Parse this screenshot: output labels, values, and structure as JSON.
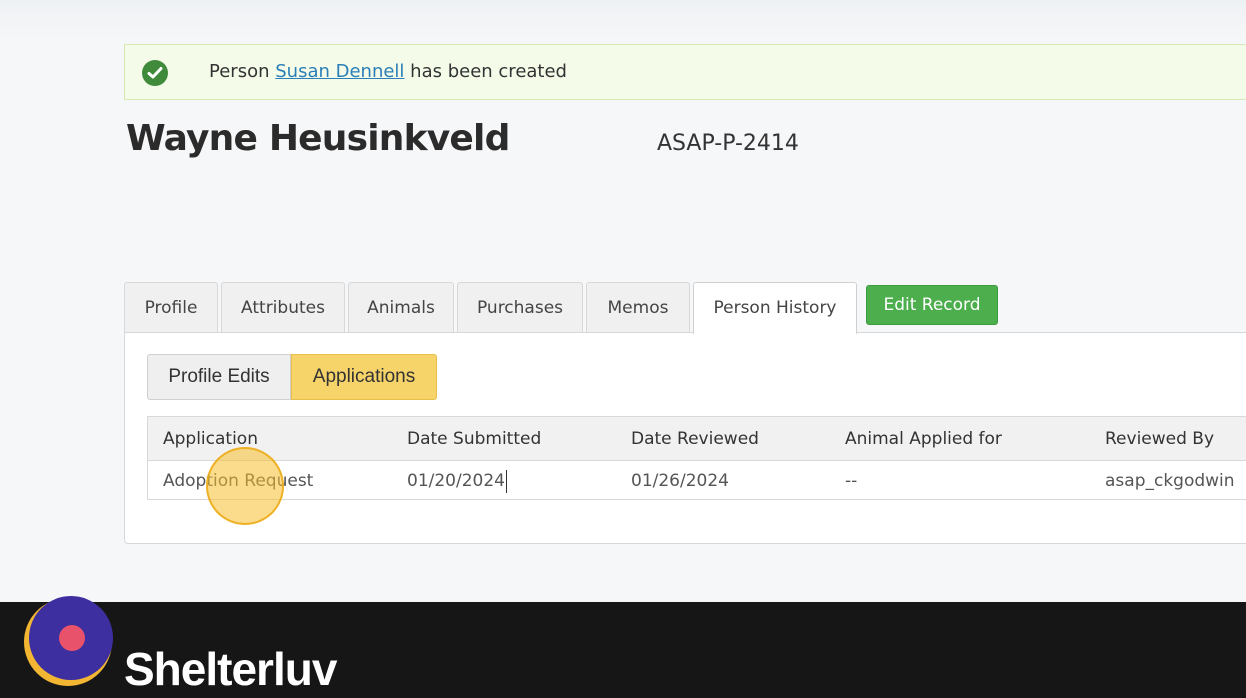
{
  "alert": {
    "prefix": "Person",
    "link_text": "Susan Dennell",
    "suffix": "has been created",
    "icon": "check-circle-icon"
  },
  "person": {
    "name": "Wayne Heusinkveld",
    "id": "ASAP-P-2414"
  },
  "tabs": [
    {
      "label": "Profile",
      "active": false
    },
    {
      "label": "Attributes",
      "active": false
    },
    {
      "label": "Animals",
      "active": false
    },
    {
      "label": "Purchases",
      "active": false
    },
    {
      "label": "Memos",
      "active": false
    },
    {
      "label": "Person History",
      "active": true
    }
  ],
  "edit_button": "Edit Record",
  "subtabs": [
    {
      "label": "Profile Edits",
      "active": false
    },
    {
      "label": "Applications",
      "active": true
    }
  ],
  "table": {
    "columns": [
      "Application",
      "Date Submitted",
      "Date Reviewed",
      "Animal Applied for",
      "Reviewed By"
    ],
    "rows": [
      [
        "Adoption Request",
        "01/20/2024",
        "01/26/2024",
        "--",
        "asap_ckgodwin"
      ]
    ]
  },
  "branding": {
    "name": "Shelterluv",
    "colors": {
      "logo_circle": "#3d2fa0",
      "logo_dot": "#e8526b",
      "logo_ring": "#f2b632"
    }
  },
  "colors": {
    "success_green": "#4cae4c",
    "active_subtab": "#f7d46a",
    "link": "#2a7fb8"
  }
}
